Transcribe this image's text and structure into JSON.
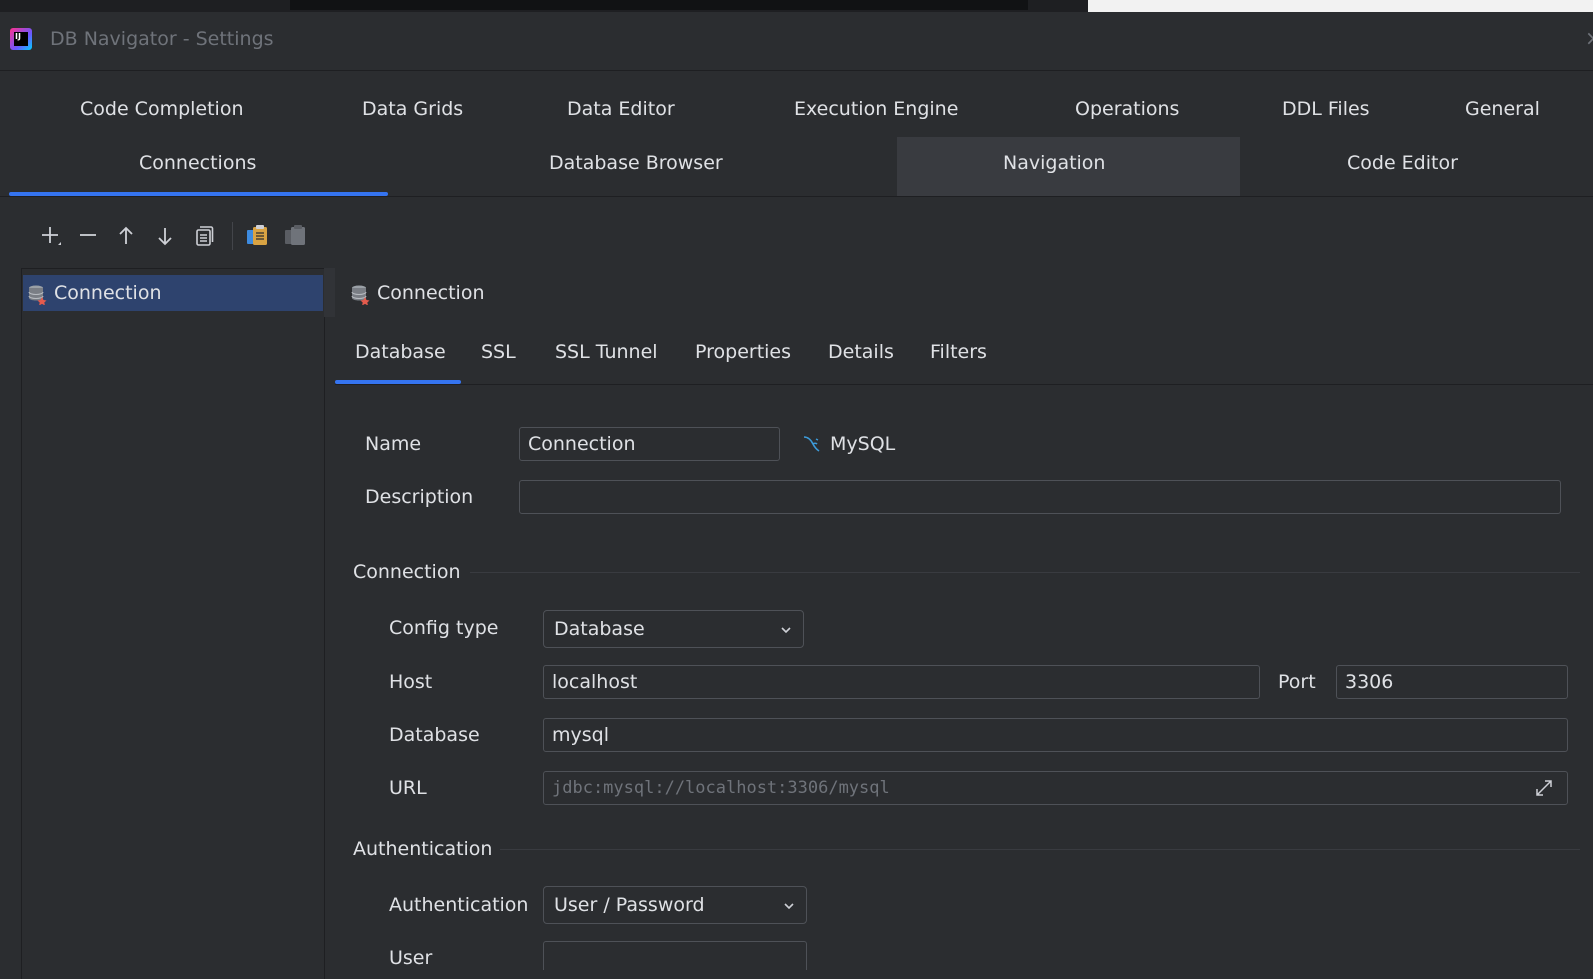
{
  "window": {
    "title": "DB Navigator - Settings"
  },
  "tabs_row1": [
    "Code Completion",
    "Data Grids",
    "Data Editor",
    "Execution Engine",
    "Operations",
    "DDL Files",
    "General"
  ],
  "tabs_row2": [
    "Connections",
    "Database Browser",
    "Navigation",
    "Code Editor"
  ],
  "toolbar": {
    "icons": [
      "add-icon",
      "remove-icon",
      "move-up-icon",
      "move-down-icon",
      "copy-icon",
      "copy-connections-icon",
      "paste-connections-icon"
    ]
  },
  "connections_list": [
    {
      "label": "Connection",
      "icon": "database-connection-icon",
      "selected": true
    }
  ],
  "panel": {
    "title": "Connection"
  },
  "sub_tabs": [
    "Database",
    "SSL",
    "SSL Tunnel",
    "Properties",
    "Details",
    "Filters"
  ],
  "form": {
    "name_label": "Name",
    "name_value": "Connection",
    "db_type": "MySQL",
    "description_label": "Description",
    "description_value": "",
    "connection_section": "Connection",
    "config_type_label": "Config type",
    "config_type_value": "Database",
    "host_label": "Host",
    "host_value": "localhost",
    "port_label": "Port",
    "port_value": "3306",
    "database_label": "Database",
    "database_value": "mysql",
    "url_label": "URL",
    "url_value": "jdbc:mysql://localhost:3306/mysql",
    "auth_section": "Authentication",
    "authentication_label": "Authentication",
    "authentication_value": "User / Password",
    "user_label": "User",
    "user_value": ""
  },
  "colors": {
    "accent": "#3574f0",
    "background": "#2b2d30",
    "selection": "#2e436e",
    "text": "#dfe1e5"
  }
}
